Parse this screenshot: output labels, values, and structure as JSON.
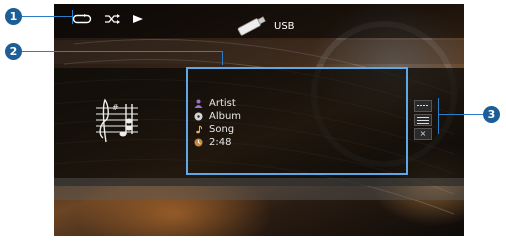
{
  "status_bar": {
    "repeat_icon": "repeat-icon",
    "shuffle_icon": "shuffle-icon",
    "play_icon": "play-icon"
  },
  "source": {
    "icon": "usb-stick-icon",
    "label": "USB"
  },
  "track": {
    "artist": "Artist",
    "album": "Album",
    "song": "Song",
    "time": "2:48"
  },
  "operations": {
    "menu_icon": "dotted-menu-icon",
    "list_icon": "list-icon",
    "close_label": "×"
  },
  "callouts": [
    "1",
    "2",
    "3"
  ],
  "colors": {
    "callout": "#1d5e97",
    "highlight": "#5fa8e8"
  }
}
